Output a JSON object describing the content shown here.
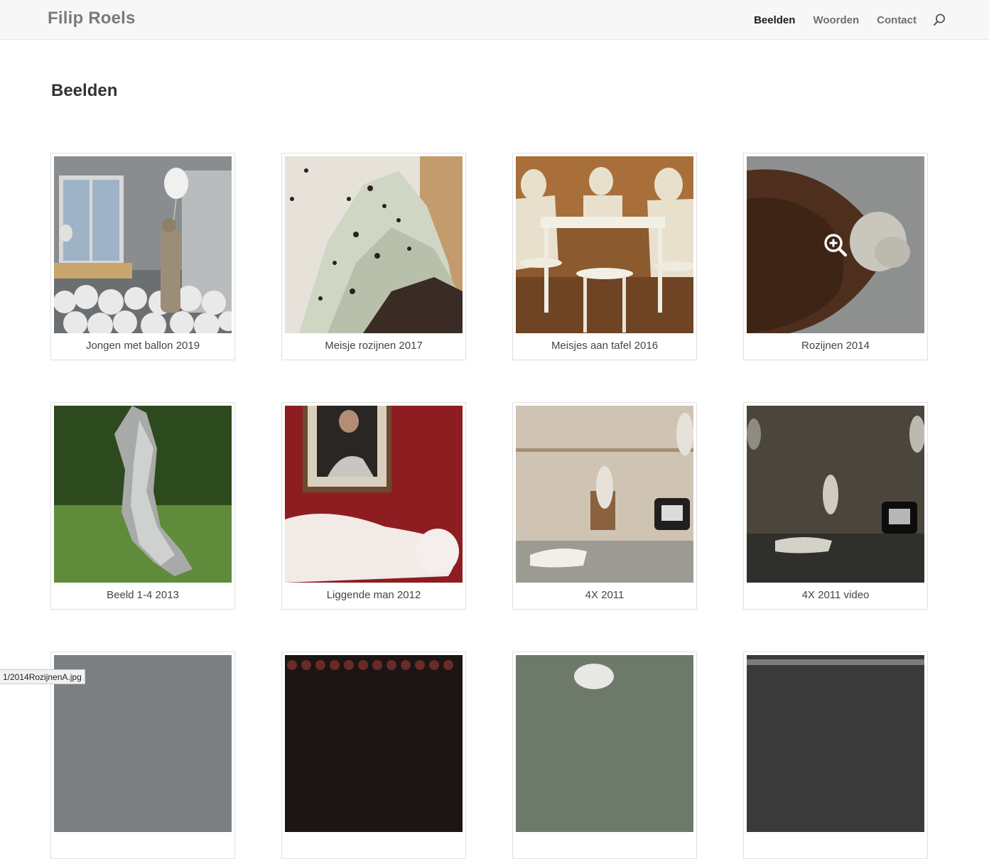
{
  "site": {
    "title": "Filip Roels"
  },
  "nav": {
    "items": [
      {
        "label": "Beelden",
        "active": true
      },
      {
        "label": "Woorden",
        "active": false
      },
      {
        "label": "Contact",
        "active": false
      }
    ],
    "search_icon": "search-icon"
  },
  "page": {
    "title": "Beelden"
  },
  "gallery": {
    "items": [
      {
        "caption": "Jongen met ballon 2019"
      },
      {
        "caption": "Meisje rozijnen 2017"
      },
      {
        "caption": "Meisjes aan tafel 2016"
      },
      {
        "caption": "Rozijnen 2014",
        "hover_icon": "zoom-in-icon"
      },
      {
        "caption": "Beeld 1-4 2013"
      },
      {
        "caption": "Liggende man 2012"
      },
      {
        "caption": "4X 2011"
      },
      {
        "caption": "4X 2011 video"
      },
      {
        "caption": ""
      },
      {
        "caption": ""
      },
      {
        "caption": ""
      },
      {
        "caption": ""
      }
    ]
  },
  "statusbar": {
    "url": "1/2014RozijnenA.jpg"
  }
}
